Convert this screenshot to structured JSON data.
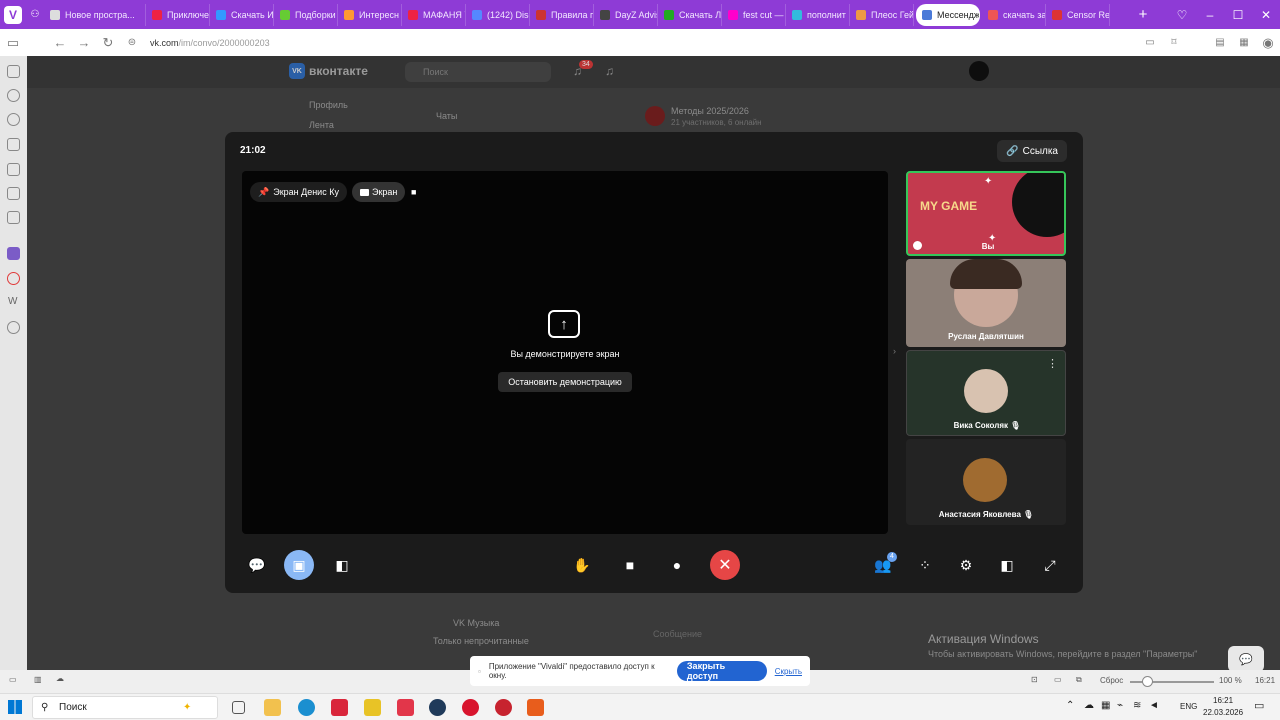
{
  "browser": {
    "tabs": [
      "Новое простра...",
      "Приключе",
      "Скачать И",
      "Подборки",
      "Интересн",
      "МАФАНЯ Y",
      "(1242) Disc",
      "Правила п",
      "DayZ Advis",
      "Скачать Л",
      "fest cut —",
      "пополнит",
      "Плеос Гейк",
      "Мессендж",
      "скачать за",
      "Censor Rep"
    ],
    "active_tab_index": 13,
    "url_host": "vk.com",
    "url_path": "/im/convo/2000000203",
    "zoom": "100 %",
    "reset_label": "Сброс",
    "time_right": "16:21"
  },
  "vk": {
    "logo": "вконтакте",
    "search_placeholder": "Поиск",
    "notif_count": "34",
    "menu": [
      "Профиль",
      "Лента"
    ],
    "chats_label": "Чаты",
    "chat_title": "Методы 2025/2026",
    "chat_subtitle": "21 участников, 6 онлайн",
    "unread_only": "Только непрочитанные",
    "vk_music": "VK Музыка",
    "message_placeholder": "Сообщение"
  },
  "call": {
    "time": "21:02",
    "link_label": "Ссылка",
    "pin_chip": "Экран Денис Ку",
    "screen_chip": "Экран",
    "sharing_text": "Вы демонстрируете экран",
    "stop_label": "Остановить демонстрацию",
    "participants": [
      {
        "name": "Вы",
        "banner": "MY GAME"
      },
      {
        "name": "Руслан Давлятшин"
      },
      {
        "name": "Вика Соколяк"
      },
      {
        "name": "Анастасия Яковлева"
      }
    ],
    "participants_badge": "4"
  },
  "windows": {
    "activation_title": "Активация Windows",
    "activation_sub": "Чтобы активировать Windows, перейдите в раздел \"Параметры\"",
    "search_label": "Поиск",
    "lang": "ENG",
    "time": "16:21",
    "date": "22.03.2026"
  },
  "permission": {
    "text": "Приложение \"Vivaldi\" предоставило доступ к окну.",
    "close_label": "Закрыть доступ",
    "hide_label": "Скрыть"
  },
  "colors": {
    "browser_accent": "#8e3bd6",
    "end_call": "#e64646",
    "active_border": "#36c65a",
    "permission_button": "#2264d1"
  }
}
